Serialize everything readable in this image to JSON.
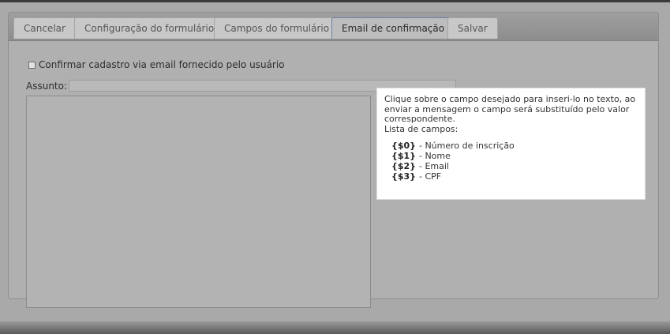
{
  "tabs": [
    {
      "label": "Cancelar"
    },
    {
      "label": "Configuração do formulário"
    },
    {
      "label": "Campos do formulário"
    },
    {
      "label": "Email de confirmação",
      "active": true
    },
    {
      "label": "Salvar"
    }
  ],
  "confirm_checkbox": {
    "label": "Confirmar cadastro via email fornecido pelo usuário",
    "checked": false
  },
  "subject": {
    "label": "Assunto:",
    "value": ""
  },
  "message": {
    "value": ""
  },
  "help": {
    "intro": "Clique sobre o campo desejado para inseri-lo no texto, ao enviar a mensagem o campo será substituído pelo valor correspondente.",
    "list_title": "Lista de campos:",
    "fields": [
      {
        "token": "{$0}",
        "desc": "- Número de inscrição"
      },
      {
        "token": "{$1}",
        "desc": "- Nome"
      },
      {
        "token": "{$2}",
        "desc": "- Email"
      },
      {
        "token": "{$3}",
        "desc": "- CPF"
      }
    ]
  }
}
